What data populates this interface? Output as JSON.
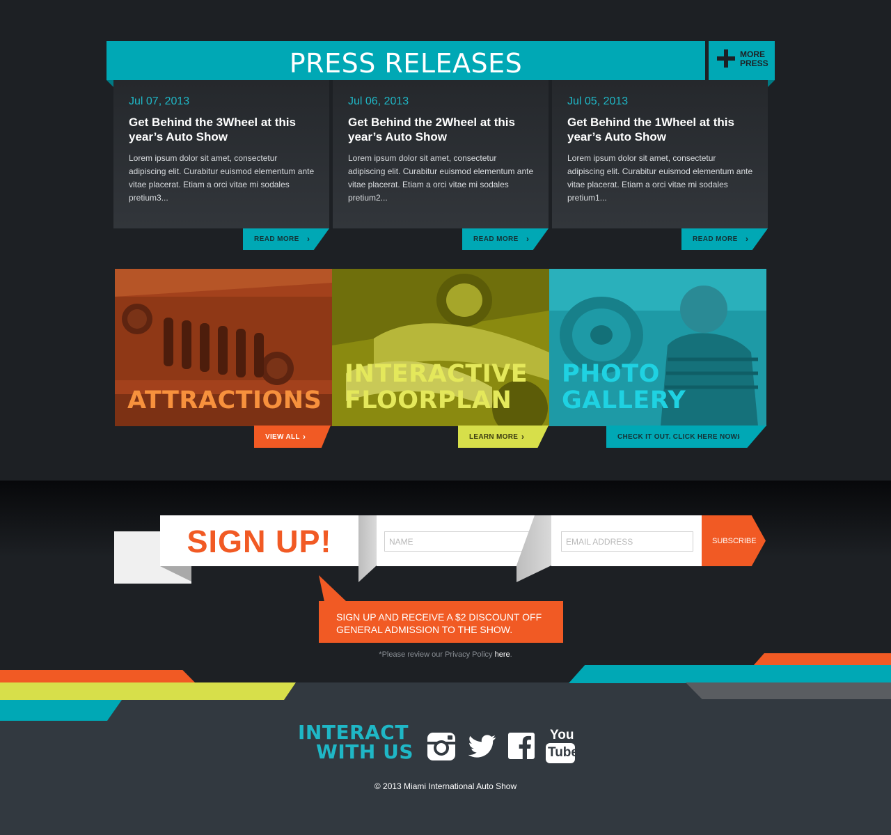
{
  "press": {
    "title": "PRESS RELEASES",
    "more_label": "MORE PRESS",
    "items": [
      {
        "date": "Jul 07, 2013",
        "headline": "Get Behind the 3Wheel at this year’s Auto Show",
        "body": "Lorem ipsum dolor sit amet, consectetur adipiscing elit. Curabitur euismod elementum ante vitae placerat. Etiam a orci vitae mi sodales pretium3...",
        "cta": "READ MORE"
      },
      {
        "date": "Jul 06, 2013",
        "headline": "Get Behind the 2Wheel at this year’s Auto Show",
        "body": "Lorem ipsum dolor sit amet, consectetur adipiscing elit. Curabitur euismod elementum ante vitae placerat. Etiam a orci vitae mi sodales pretium2...",
        "cta": "READ MORE"
      },
      {
        "date": "Jul 05, 2013",
        "headline": "Get Behind the 1Wheel at this year’s Auto Show",
        "body": "Lorem ipsum dolor sit amet, consectetur adipiscing elit. Curabitur euismod elementum ante vitae placerat. Etiam a orci vitae mi sodales pretium1...",
        "cta": "READ MORE"
      }
    ]
  },
  "features": {
    "attractions": {
      "title": "ATTRACTIONS",
      "cta": "VIEW ALL"
    },
    "floorplan": {
      "title_line1": "INTERACTIVE",
      "title_line2": "FLOORPLAN",
      "cta": "LEARN MORE"
    },
    "gallery": {
      "title_line1": "PHOTO",
      "title_line2": "GALLERY",
      "cta": "CHECK IT OUT. CLICK HERE NOW!"
    }
  },
  "signup": {
    "title": "SIGN UP!",
    "name_placeholder": "NAME",
    "email_placeholder": "EMAIL ADDRESS",
    "subscribe_label": "SUBSCRIBE",
    "promo": "SIGN UP AND RECEIVE A $2 DISCOUNT OFF GENERAL ADMISSION TO THE SHOW.",
    "privacy_text": "*Please review our Privacy Policy ",
    "privacy_link": "here",
    "privacy_end": "."
  },
  "footer": {
    "interact_line1": "INTERACT",
    "interact_line2": "WITH US",
    "social": [
      {
        "icon": "instagram-icon"
      },
      {
        "icon": "twitter-icon"
      },
      {
        "icon": "facebook-icon"
      },
      {
        "icon": "youtube-icon",
        "label_top": "You",
        "label_bottom": "Tube"
      }
    ],
    "copyright": "© 2013 Miami International Auto Show"
  },
  "colors": {
    "teal": "#00a8b5",
    "orange": "#f15a24",
    "lime": "#d7df4a",
    "dark": "#1d2024",
    "footer": "#323940"
  }
}
